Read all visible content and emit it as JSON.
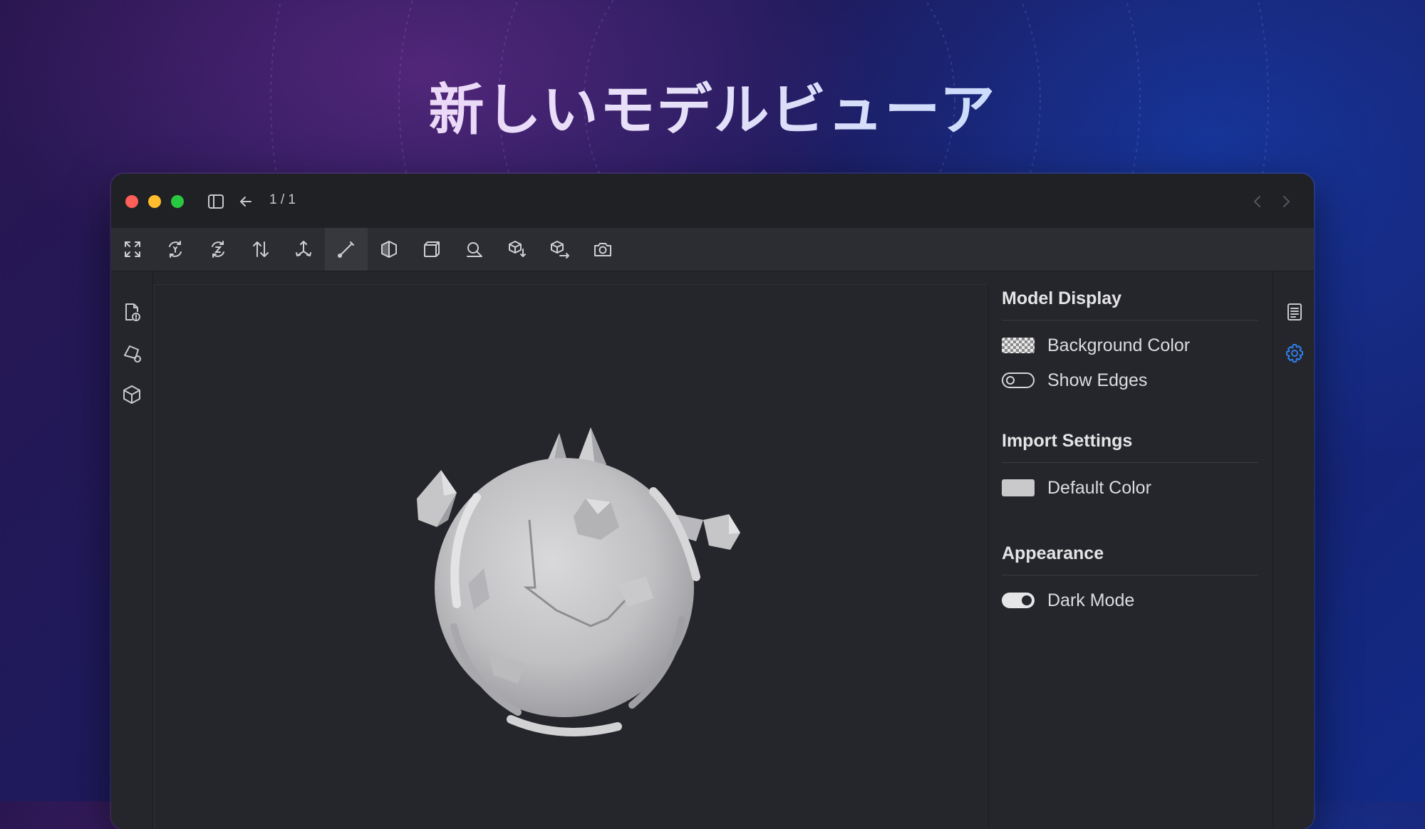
{
  "headline": "新しいモデルビューア",
  "window": {
    "page_counter": "1 / 1",
    "traffic_lights": [
      "close",
      "minimize",
      "zoom"
    ],
    "titlebar_icons": [
      "sidebar-toggle-icon",
      "back-arrow-icon",
      "chevron-left-icon",
      "chevron-right-icon"
    ]
  },
  "toolbar": {
    "tools": [
      {
        "icon": "fit-view-icon",
        "active": false
      },
      {
        "icon": "rotate-y-icon",
        "active": false
      },
      {
        "icon": "rotate-z-icon",
        "active": false
      },
      {
        "icon": "flip-vertical-icon",
        "active": false
      },
      {
        "icon": "axis-icon",
        "active": true
      },
      {
        "icon": "measure-line-icon",
        "active": true
      },
      {
        "icon": "section-cut-icon",
        "active": false
      },
      {
        "icon": "orthographic-icon",
        "active": false
      },
      {
        "icon": "zoom-region-icon",
        "active": false
      },
      {
        "icon": "drop-model-icon",
        "active": false
      },
      {
        "icon": "move-model-icon",
        "active": false
      },
      {
        "icon": "camera-icon",
        "active": false
      }
    ]
  },
  "left_sidebar": [
    "file-info-icon",
    "shapes-icon",
    "cube-icon"
  ],
  "right_sidebar": [
    "document-list-icon",
    "settings-gear-icon"
  ],
  "accent_color": "#2f7de8",
  "settings": {
    "model_display": {
      "title": "Model Display",
      "background_color_label": "Background Color",
      "show_edges_label": "Show Edges",
      "show_edges_enabled": false
    },
    "import_settings": {
      "title": "Import Settings",
      "default_color_label": "Default Color",
      "default_color": "#c9c9cb"
    },
    "appearance": {
      "title": "Appearance",
      "dark_mode_label": "Dark Mode",
      "dark_mode_enabled": true
    }
  }
}
